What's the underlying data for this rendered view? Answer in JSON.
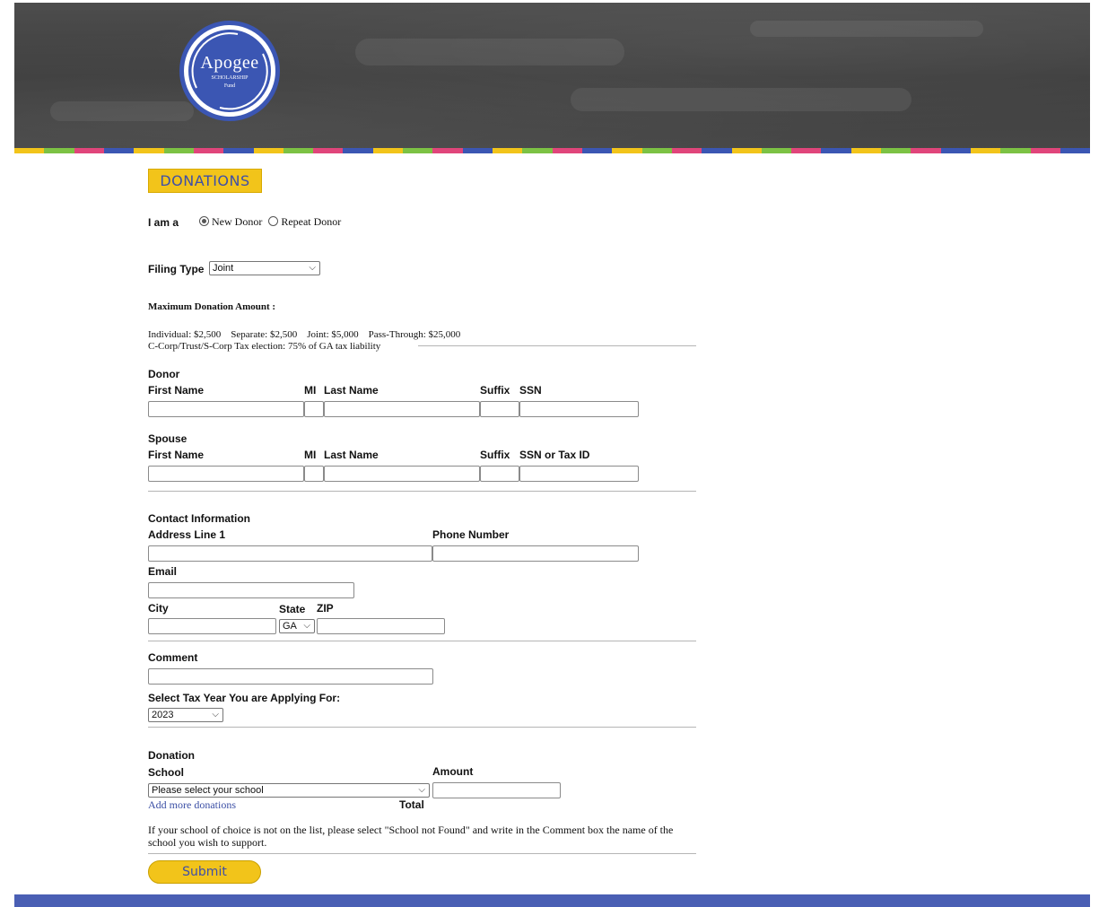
{
  "header": {
    "logo_text": "Apogee",
    "logo_sub_line1": "SCHOLARSHIP",
    "logo_sub_line2": "Fund"
  },
  "stripe_colors": [
    "#f2c41a",
    "#7cc244",
    "#e0457b",
    "#3b56b3",
    "#f2c41a",
    "#7cc244",
    "#e0457b",
    "#3b56b3",
    "#f2c41a",
    "#7cc244",
    "#e0457b",
    "#3b56b3",
    "#f2c41a",
    "#7cc244",
    "#e0457b",
    "#3b56b3",
    "#f2c41a",
    "#7cc244",
    "#e0457b",
    "#3b56b3",
    "#f2c41a",
    "#7cc244",
    "#e0457b",
    "#3b56b3",
    "#f2c41a",
    "#7cc244",
    "#e0457b",
    "#3b56b3",
    "#f2c41a",
    "#7cc244",
    "#e0457b",
    "#3b56b3",
    "#f2c41a",
    "#7cc244",
    "#e0457b",
    "#3b56b3"
  ],
  "page_title": "DONATIONS",
  "donor_type": {
    "label": "I am a",
    "options": [
      "New Donor",
      "Repeat Donor"
    ],
    "selected": "New Donor"
  },
  "filing_type": {
    "label": "Filing Type",
    "value": "Joint"
  },
  "max_donation": {
    "heading": "Maximum Donation Amount :",
    "line1": "Individual: $2,500    Separate: $2,500    Joint: $5,000    Pass-Through: $25,000",
    "line2": "C-Corp/Trust/S-Corp Tax election: 75% of GA tax liability"
  },
  "donor": {
    "section": "Donor",
    "first_name": "First Name",
    "mi": "MI",
    "last_name": "Last Name",
    "suffix": "Suffix",
    "ssn": "SSN"
  },
  "spouse": {
    "section": "Spouse",
    "first_name": "First Name",
    "mi": "MI",
    "last_name": "Last Name",
    "suffix": "Suffix",
    "ssn": "SSN or Tax ID"
  },
  "contact": {
    "section": "Contact Information",
    "address": "Address Line 1",
    "phone": "Phone Number",
    "email": "Email",
    "city": "City",
    "state": "State",
    "state_value": "GA",
    "zip": "ZIP"
  },
  "comment": {
    "label": "Comment"
  },
  "tax_year": {
    "label": "Select Tax Year You are Applying For:",
    "value": "2023"
  },
  "donation": {
    "section": "Donation",
    "school": "School",
    "amount": "Amount",
    "school_placeholder": "Please select your school",
    "add_more": "Add more donations",
    "total": "Total",
    "note": "If your school of choice is not on the list, please select \"School not Found\" and write in the Comment box the name of the school you wish to support."
  },
  "submit_label": "Submit",
  "icons": {
    "radio": "radio-icon",
    "chevron": "chevron-down-icon"
  }
}
